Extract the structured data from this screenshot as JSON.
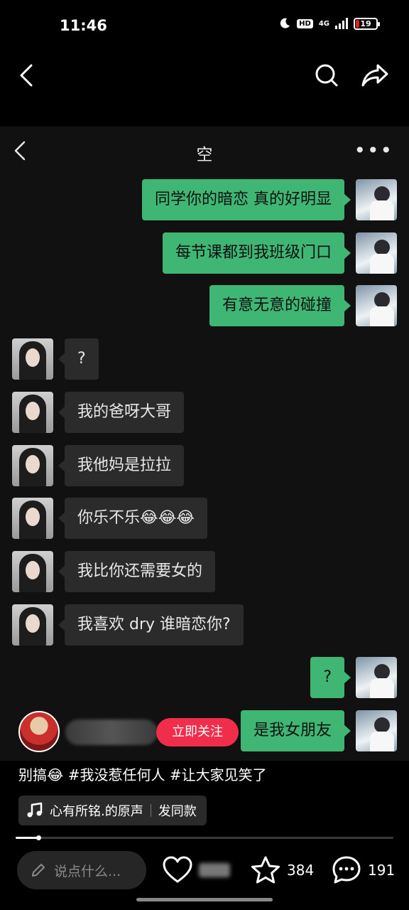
{
  "status_bar": {
    "time": "11:46",
    "hd": "HD",
    "network": "4G",
    "battery": "19",
    "battery_level": 0.19,
    "battery_color": "#e02020"
  },
  "top_nav": {
    "back_icon": "chevron-left-icon",
    "search_icon": "search-icon",
    "share_icon": "share-arrow-icon"
  },
  "chat": {
    "title": "空",
    "more": "•••",
    "messages": [
      {
        "side": "right",
        "text": "同学你的暗恋  真的好明显"
      },
      {
        "side": "right",
        "text": "每节课都到我班级门口"
      },
      {
        "side": "right",
        "text": "有意无意的碰撞"
      },
      {
        "side": "left",
        "text": "?"
      },
      {
        "side": "left",
        "text": "我的爸呀大哥"
      },
      {
        "side": "left",
        "text": "我他妈是拉拉"
      },
      {
        "side": "left",
        "text": "你乐不乐😂😂😂"
      },
      {
        "side": "left",
        "text": "我比你还需要女的"
      },
      {
        "side": "left",
        "text": "我喜欢 dry 谁暗恋你?"
      },
      {
        "side": "right",
        "text": "?"
      },
      {
        "side": "right",
        "text": "是我女朋友"
      }
    ],
    "colors": {
      "sent": "#3fb674",
      "received": "#2b2b2b"
    }
  },
  "creator": {
    "follow_label": "立即关注",
    "follow_color": "#f02d4a"
  },
  "caption": "别搞😂 #我没惹任何人 #让大家见笑了",
  "music": {
    "title": "心有所铭.的原声",
    "action": "发同款",
    "icon": "music-note-icon"
  },
  "progress": {
    "fraction": 0.06
  },
  "bottom_bar": {
    "comment_placeholder": "说点什么...",
    "favorites_count": "384",
    "comments_count": "191"
  }
}
